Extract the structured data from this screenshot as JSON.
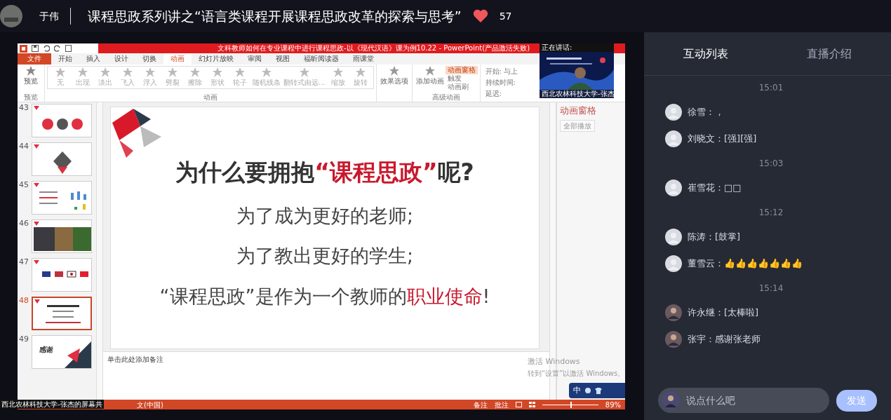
{
  "header": {
    "host": "于伟",
    "title": "课程思政系列讲之“语言类课程开展课程思政改革的探索与思考”",
    "likes": "57"
  },
  "screen_share": {
    "window_title": "文科教师如何在专业课程中进行课程思政-以《现代汉语》课为例10.22 - PowerPoint(产品激活失败)",
    "ribbon_tabs": [
      {
        "label": "文件",
        "kind": "file",
        "selected": false
      },
      {
        "label": "开始",
        "kind": "tab",
        "selected": false
      },
      {
        "label": "插入",
        "kind": "tab",
        "selected": false
      },
      {
        "label": "设计",
        "kind": "tab",
        "selected": false
      },
      {
        "label": "切换",
        "kind": "tab",
        "selected": false
      },
      {
        "label": "动画",
        "kind": "tab",
        "selected": true
      },
      {
        "label": "幻灯片放映",
        "kind": "tab",
        "selected": false
      },
      {
        "label": "审阅",
        "kind": "tab",
        "selected": false
      },
      {
        "label": "视图",
        "kind": "tab",
        "selected": false
      },
      {
        "label": "福昕阅读器",
        "kind": "tab",
        "selected": false
      },
      {
        "label": "雨课堂",
        "kind": "tab",
        "selected": false
      }
    ],
    "preview": {
      "label": "预览",
      "group": "预览"
    },
    "animations": [
      "无",
      "出现",
      "淡出",
      "飞入",
      "浮入",
      "劈裂",
      "擦除",
      "形状",
      "轮子",
      "随机线条",
      "翻转式由远...",
      "缩放",
      "旋转"
    ],
    "animation_group": "动画",
    "effect_options": "效果选项",
    "add_animation": "添加动画",
    "advanced": [
      {
        "label": "动画窗格",
        "selected": true
      },
      {
        "label": "触发",
        "selected": false
      },
      {
        "label": "动画刷",
        "selected": false
      }
    ],
    "advanced_group": "高级动画",
    "timing": [
      "开始: 与上",
      "持续时间:",
      "延迟:"
    ],
    "speaker": {
      "label": "正在讲话:",
      "caption": "西北农林科技大学-张杰"
    },
    "thumbnails": [
      {
        "number": "43",
        "selected": false
      },
      {
        "number": "44",
        "selected": false
      },
      {
        "number": "45",
        "selected": false
      },
      {
        "number": "46",
        "selected": false
      },
      {
        "number": "47",
        "selected": false
      },
      {
        "number": "48",
        "selected": true
      },
      {
        "number": "49",
        "selected": false,
        "title": "感谢"
      }
    ],
    "slide": {
      "title": [
        {
          "text": "为什么要拥抱",
          "emphasis": false
        },
        {
          "text": "“课程思政”",
          "emphasis": true
        },
        {
          "text": "呢?",
          "emphasis": false
        }
      ],
      "lines": [
        [
          {
            "text": "为了成为更好的老师;",
            "emphasis": false
          }
        ],
        [
          {
            "text": "为了教出更好的学生;",
            "emphasis": false
          }
        ],
        [
          {
            "text": "“课程思政”是作为一个教师的",
            "emphasis": false
          },
          {
            "text": "职业使命",
            "emphasis": true
          },
          {
            "text": "!",
            "emphasis": false
          }
        ]
      ]
    },
    "notes_placeholder": "单击此处添加备注",
    "animation_pane": {
      "title": "动画窗格",
      "play_button": "全部播放"
    },
    "activation": {
      "title": "激活 Windows",
      "hint": "转到“设置”以激活 Windows。"
    },
    "ime": "中",
    "status_bar": {
      "language": "文(中国)",
      "notes": "备注",
      "comments": "批注",
      "zoom": "89%",
      "level": 0.5
    },
    "share_label": "西北农林科技大学-张杰的屏幕共"
  },
  "chat": {
    "tabs": [
      {
        "label": "互动列表",
        "selected": true
      },
      {
        "label": "直播介绍",
        "selected": false
      }
    ],
    "messages": [
      {
        "kind": "time",
        "text": "15:01"
      },
      {
        "kind": "message",
        "text": "徐雪：，",
        "avatar_photo": false
      },
      {
        "kind": "message",
        "text": "刘晓文：[强][强]",
        "avatar_photo": false
      },
      {
        "kind": "time",
        "text": "15:03"
      },
      {
        "kind": "message",
        "text": "崔雪花：□□",
        "avatar_photo": false
      },
      {
        "kind": "time",
        "text": "15:12"
      },
      {
        "kind": "message",
        "text": "陈涛：[鼓掌]",
        "avatar_photo": false
      },
      {
        "kind": "message",
        "text": "董雪云：👍👍👍👍👍👍👍",
        "avatar_photo": false
      },
      {
        "kind": "time",
        "text": "15:14"
      },
      {
        "kind": "message",
        "text": "许永继：[太棒啦]",
        "avatar_photo": true
      },
      {
        "kind": "message",
        "text": "张宇：感谢张老师",
        "avatar_photo": true
      }
    ],
    "input": {
      "placeholder": "说点什么吧"
    },
    "send": "发送"
  }
}
